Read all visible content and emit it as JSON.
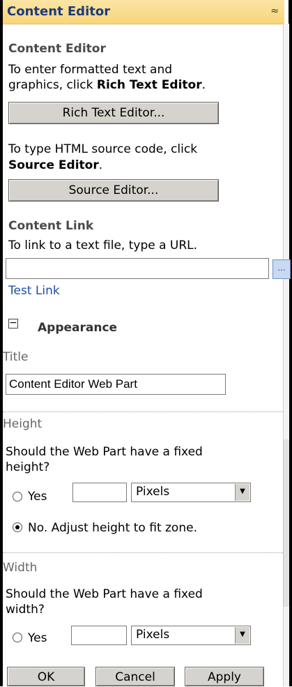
{
  "panel": {
    "title": "Content Editor",
    "collapse_glyph": "≈"
  },
  "content_editor": {
    "heading": "Content Editor",
    "rte_line1": "To enter formatted text and",
    "rte_line2_prefix": "graphics, click ",
    "rte_line2_bold": "Rich Text Editor",
    "rte_line2_suffix": ".",
    "rte_button": "Rich Text Editor...",
    "src_line1": "To type HTML source code, click",
    "src_bold": "Source Editor",
    "src_suffix": ".",
    "src_button": "Source Editor..."
  },
  "content_link": {
    "heading": "Content Link",
    "description": "To link to a text file, type a URL.",
    "url_value": "",
    "browse_label": "...",
    "test_link": "Test Link"
  },
  "appearance": {
    "toggle_glyph": "−",
    "heading": "Appearance",
    "title_label": "Title",
    "title_value": "Content Editor Web Part",
    "height_label": "Height",
    "height_q1": "Should the Web Part have a fixed",
    "height_q2": "height?",
    "height_yes": "Yes",
    "height_value": "",
    "height_unit": "Pixels",
    "height_no": "No. Adjust height to fit zone.",
    "width_label": "Width",
    "width_q1": "Should the Web Part have a fixed",
    "width_q2": "width?",
    "width_yes": "Yes",
    "width_value": "",
    "width_unit": "Pixels"
  },
  "footer": {
    "ok": "OK",
    "cancel": "Cancel",
    "apply": "Apply"
  }
}
